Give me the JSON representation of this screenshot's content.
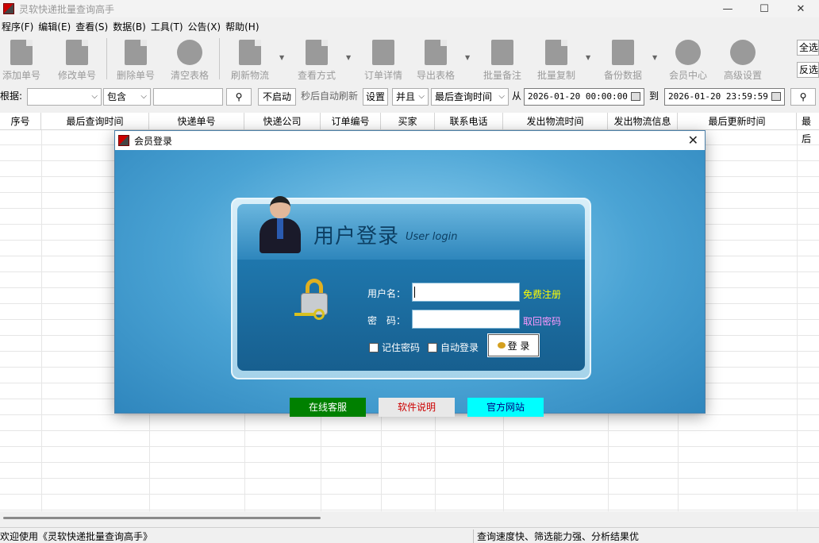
{
  "app": {
    "title": "灵软快递批量查询高手",
    "window_buttons": {
      "minimize": "—",
      "maximize": "☐",
      "close": "✕"
    }
  },
  "menu": [
    {
      "label": "程序(F)"
    },
    {
      "label": "编辑(E)"
    },
    {
      "label": "查看(S)"
    },
    {
      "label": "数据(B)"
    },
    {
      "label": "工具(T)"
    },
    {
      "label": "公告(X)"
    },
    {
      "label": "帮助(H)"
    }
  ],
  "toolbar": {
    "buttons": [
      {
        "label": "添加单号",
        "icon": "doc-icon"
      },
      {
        "label": "修改单号",
        "icon": "edit-icon"
      },
      {
        "label": "删除单号",
        "icon": "delete-icon"
      },
      {
        "label": "清空表格",
        "icon": "clear-icon"
      },
      {
        "label": "刷新物流",
        "icon": "refresh-icon"
      },
      {
        "label": "查看方式",
        "icon": "view-icon"
      },
      {
        "label": "订单详情",
        "icon": "detail-icon"
      },
      {
        "label": "导出表格",
        "icon": "export-icon"
      },
      {
        "label": "批量备注",
        "icon": "note-icon"
      },
      {
        "label": "批量复制",
        "icon": "copy-icon"
      },
      {
        "label": "备份数据",
        "icon": "backup-icon"
      },
      {
        "label": "会员中心",
        "icon": "member-icon"
      },
      {
        "label": "高级设置",
        "icon": "settings-icon"
      }
    ],
    "select_all": "全选",
    "invert": "反选"
  },
  "filter": {
    "basis_label": "根据:",
    "match_value": "包含",
    "auto_button": "不启动",
    "auto_label": "秒后自动刷新",
    "settings_button": "设置",
    "logic_value": "并且",
    "field_value": "最后查询时间",
    "from_label": "从",
    "from_value": "2026-01-20 00:00:00",
    "to_label": "到",
    "to_value": "2026-01-20 23:59:59",
    "search_icon": "search-icon"
  },
  "grid": {
    "columns": [
      "序号",
      "最后查询时间",
      "快递单号",
      "快递公司",
      "订单编号",
      "买家",
      "联系电话",
      "发出物流时间",
      "发出物流信息",
      "最后更新时间",
      "最后"
    ]
  },
  "status": {
    "left": "欢迎使用《灵软快递批量查询高手》",
    "right": "查询速度快、筛选能力强、分析结果优"
  },
  "dialog": {
    "title": "会员登录",
    "close": "✕",
    "header_cn": "用户登录",
    "header_en": "User login",
    "username_label": "用户名：",
    "password_label": "密　码：",
    "register_link": "免费注册",
    "recover_link": "取回密码",
    "remember_label": "记住密码",
    "autologin_label": "自动登录",
    "login_button": "登 录",
    "bottom_buttons": [
      {
        "label": "在线客服",
        "bg": "#008000",
        "color": "#ffffff"
      },
      {
        "label": "软件说明",
        "bg": "#e8e8e8",
        "color": "#cc0000"
      },
      {
        "label": "官方网站",
        "bg": "#00ffff",
        "color": "#000080"
      }
    ],
    "colors": {
      "register": "#ffff00",
      "recover": "#ff99ff"
    }
  }
}
